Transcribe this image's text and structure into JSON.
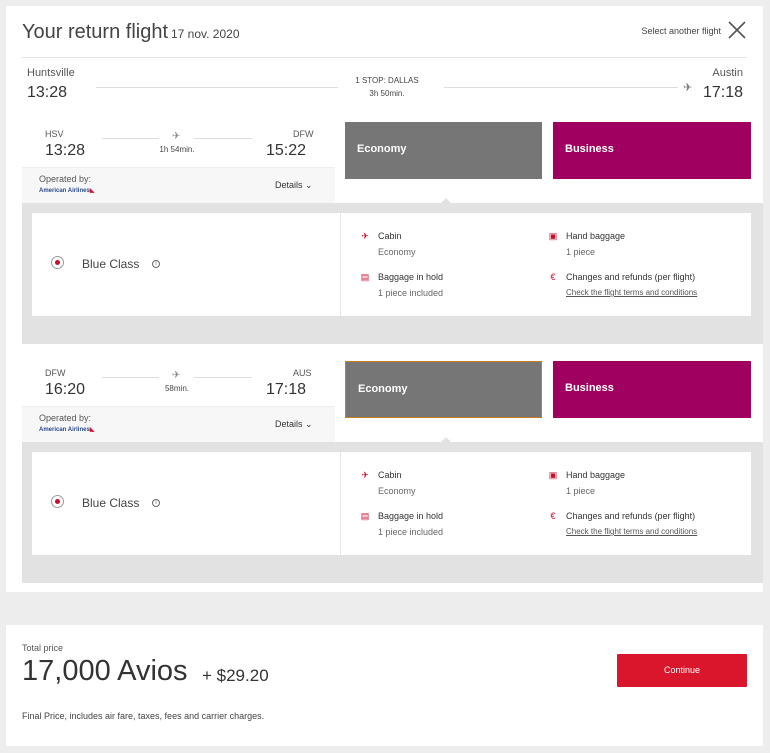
{
  "header": {
    "title": "Your return flight",
    "date": "17 nov. 2020",
    "select_another": "Select another flight"
  },
  "summary": {
    "departure_city": "Huntsville",
    "departure_time": "13:28",
    "stops": "1 STOP: DALLAS",
    "duration": "3h 50min.",
    "arrival_city": "Austin",
    "arrival_time": "17:18"
  },
  "segments": [
    {
      "from_code": "HSV",
      "from_time": "13:28",
      "duration": "1h 54min.",
      "to_code": "DFW",
      "to_time": "15:22",
      "operated_by": "Operated by:",
      "airline": "American Airlines",
      "details": "Details",
      "fares": {
        "economy": "Economy",
        "business": "Business"
      },
      "selected_fare": "economy",
      "fare_class": "Blue Class",
      "features": {
        "cabin_label": "Cabin",
        "cabin_value": "Economy",
        "hand_baggage_label": "Hand baggage",
        "hand_baggage_value": "1 piece",
        "hold_baggage_label": "Baggage in hold",
        "hold_baggage_value": "1 piece included",
        "changes_label": "Changes and refunds (per flight)",
        "terms_link": "Check the flight terms and conditions"
      }
    },
    {
      "from_code": "DFW",
      "from_time": "16:20",
      "duration": "58min.",
      "to_code": "AUS",
      "to_time": "17:18",
      "operated_by": "Operated by:",
      "airline": "American Airlines",
      "details": "Details",
      "fares": {
        "economy": "Economy",
        "business": "Business"
      },
      "selected_fare": "economy",
      "fare_class": "Blue Class",
      "features": {
        "cabin_label": "Cabin",
        "cabin_value": "Economy",
        "hand_baggage_label": "Hand baggage",
        "hand_baggage_value": "1 piece",
        "hold_baggage_label": "Baggage in hold",
        "hold_baggage_value": "1 piece included",
        "changes_label": "Changes and refunds (per flight)",
        "terms_link": "Check the flight terms and conditions"
      }
    }
  ],
  "total": {
    "label": "Total price",
    "avios": "17,000 Avios",
    "cash": "+ $29.20",
    "note": "Final Price, includes air fare, taxes, fees and carrier charges.",
    "continue": "Continue"
  },
  "colors": {
    "economy": "#767676",
    "business": "#a0005f",
    "accent_red": "#d9162c",
    "selected_border": "#c87d1e"
  },
  "icons": {
    "close": "close-icon",
    "plane": "plane-icon",
    "cabin": "seat-icon",
    "hand_baggage": "hand-baggage-icon",
    "hold_baggage": "hold-baggage-icon",
    "changes": "euro-icon",
    "info": "info-icon",
    "details_chevron": "chevron-down-icon"
  }
}
